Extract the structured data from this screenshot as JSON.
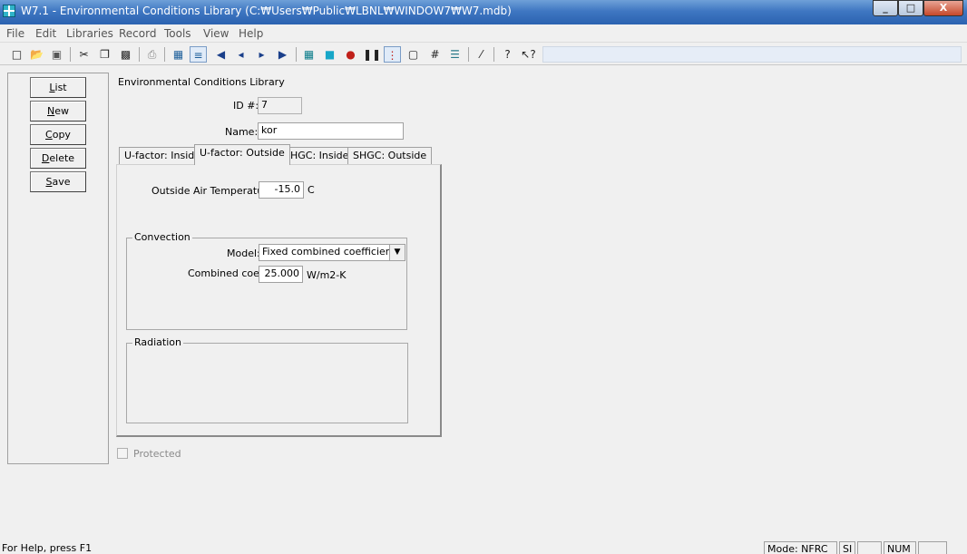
{
  "window": {
    "title": "W7.1 - Environmental Conditions Library (C:₩Users₩Public₩LBNL₩WINDOW7₩W7.mdb)",
    "minimize": "_",
    "maximize": "□",
    "close": "X"
  },
  "menu": {
    "items": [
      "File",
      "Edit",
      "Libraries",
      "Record",
      "Tools",
      "View",
      "Help"
    ]
  },
  "toolbar": {
    "icons": [
      "new-icon",
      "open-icon",
      "save-icon",
      "cut-icon",
      "copy-icon",
      "paste-icon",
      "print-icon",
      "grid-view-icon",
      "list-view-icon",
      "first-record-icon",
      "previous-record-icon",
      "next-record-icon",
      "last-record-icon",
      "calc-icon",
      "color-icon",
      "pin-icon",
      "pause-icon",
      "thermometer-icon",
      "frame-icon",
      "hash-icon",
      "striped-icon",
      "units-icon",
      "help-icon",
      "whats-this-icon"
    ]
  },
  "side_buttons": {
    "list": {
      "u": "L",
      "rest": "ist"
    },
    "new": {
      "u": "N",
      "rest": "ew"
    },
    "copy": {
      "u": "C",
      "rest": "opy"
    },
    "delete": {
      "u": "D",
      "rest": "elete"
    },
    "save": {
      "u": "S",
      "rest": "ave"
    }
  },
  "library_title": "Environmental Conditions Library",
  "form": {
    "id_label": "ID #:",
    "id_value": "7",
    "name_label": "Name:",
    "name_value": "kor"
  },
  "tabs": [
    {
      "label": "U-factor: Inside",
      "selected": false
    },
    {
      "label": "U-factor: Outside",
      "selected": true
    },
    {
      "label": "SHGC: Inside",
      "selected": false
    },
    {
      "label": "SHGC: Outside",
      "selected": false
    }
  ],
  "outside": {
    "temp_label": "Outside Air Temperature",
    "temp_value": "-15.0",
    "temp_unit": "C",
    "convection_title": "Convection",
    "model_label": "Model:",
    "model_value": "Fixed combined coefficient",
    "coef_label": "Combined coef.",
    "coef_value": "25.000",
    "coef_unit": "W/m2-K",
    "radiation_title": "Radiation"
  },
  "protected_label": "Protected",
  "status": {
    "help": "For Help, press F1",
    "mode": "Mode: NFRC",
    "units": "SI",
    "blank1": "",
    "num": "NUM",
    "blank2": ""
  }
}
